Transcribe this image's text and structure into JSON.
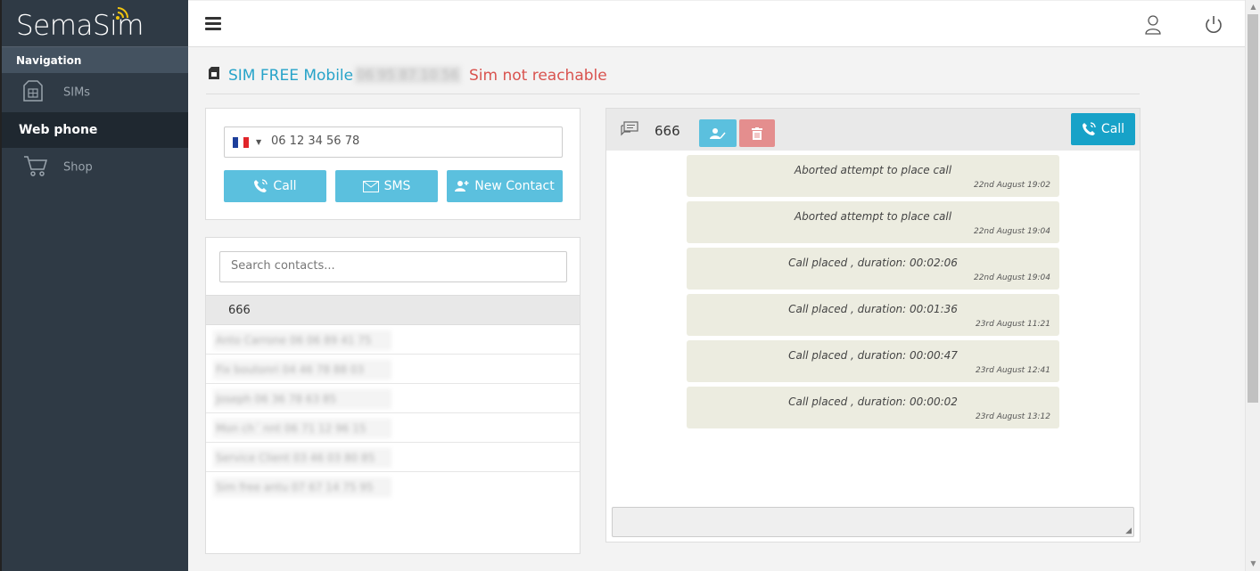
{
  "app": {
    "logo_text": "SemaSim"
  },
  "sidebar": {
    "section_label": "Navigation",
    "items": [
      {
        "label": "SIMs",
        "icon": "sim-card-icon"
      },
      {
        "label": "Web phone"
      },
      {
        "label": "Shop",
        "icon": "cart-icon"
      }
    ]
  },
  "sim": {
    "name": "SIM FREE Mobile",
    "number": "06 95 87 10 56",
    "status": "Sim not reachable",
    "status_color": "#d9534f",
    "name_color": "#27a3c9"
  },
  "dialer": {
    "country_flag": "France",
    "phone_value": "06 12 34 56 78",
    "call_label": "Call",
    "sms_label": "SMS",
    "new_contact_label": "New Contact"
  },
  "contacts": {
    "search_placeholder": "Search contacts...",
    "selected": "666",
    "items": [
      {
        "text": "Anto Carrone  06 06 89 41 75"
      },
      {
        "text": "Fix boutonri  04 46 78 88 03"
      },
      {
        "text": "Joseph  06 36 78 63 85"
      },
      {
        "text": "Mon ch´ nnt  06 71 12 96 15"
      },
      {
        "text": "Service Client  03 46 03 80 85"
      },
      {
        "text": "Sim free antu  07 67 14 75 95"
      }
    ]
  },
  "chat": {
    "contact": "666",
    "call_label": "Call",
    "messages": [
      {
        "text": "Aborted attempt to place call",
        "date": "22nd August 19:02"
      },
      {
        "text": "Aborted attempt to place call",
        "date": "22nd August 19:04"
      },
      {
        "text": "Call placed , duration: 00:02:06",
        "date": "22nd August 19:04"
      },
      {
        "text": "Call placed , duration: 00:01:36",
        "date": "23rd August 11:21"
      },
      {
        "text": "Call placed , duration: 00:00:47",
        "date": "23rd August 12:41"
      },
      {
        "text": "Call placed , duration: 00:00:02",
        "date": "23rd August 13:12"
      }
    ]
  },
  "colors": {
    "accent": "#5bc0de",
    "danger": "#e48e8e",
    "sidebar": "#2f3a45"
  }
}
